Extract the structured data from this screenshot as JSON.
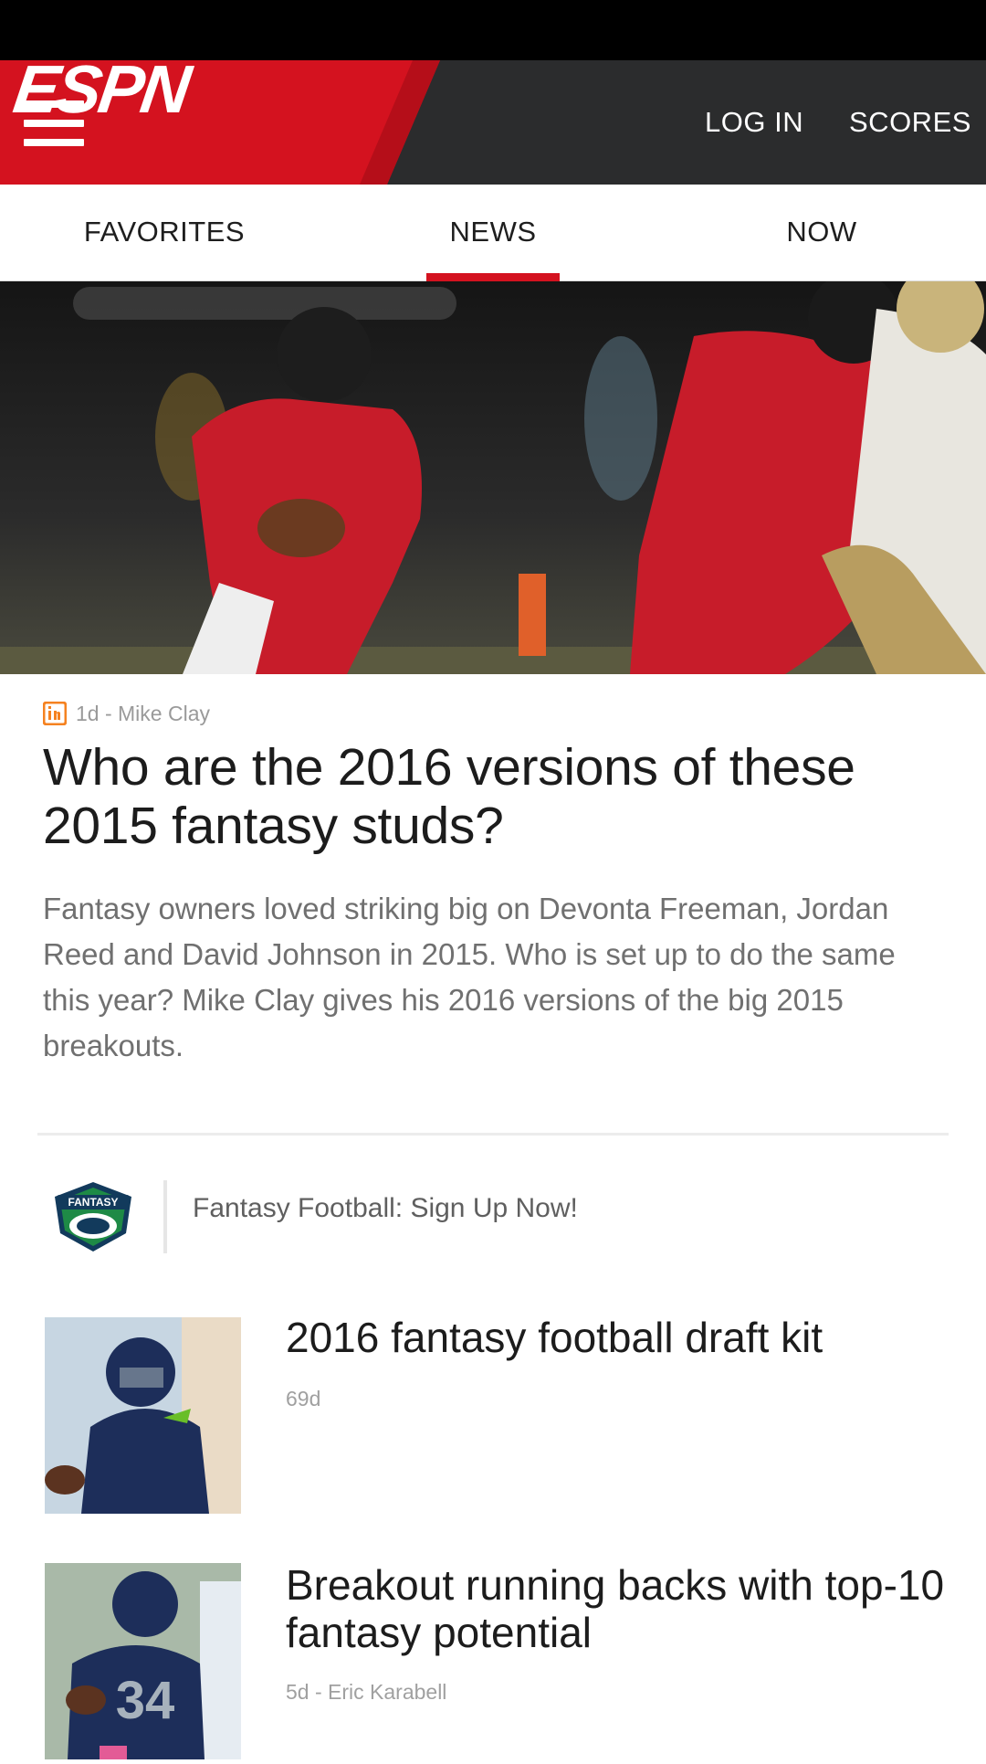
{
  "header": {
    "brand": "ESPN",
    "login_label": "LOG IN",
    "scores_label": "SCORES",
    "brand_color": "#d4121f"
  },
  "tabs": [
    {
      "label": "FAVORITES",
      "active": false
    },
    {
      "label": "NEWS",
      "active": true
    },
    {
      "label": "NOW",
      "active": false
    }
  ],
  "top_story": {
    "meta": "1d - Mike Clay",
    "badge_icon": "insider-icon",
    "headline": "Who are the 2016 versions of these 2015 fantasy studs?",
    "summary": "Fantasy owners loved striking big on Devonta Freeman, Jordan Reed and David Johnson in 2015. Who is set up to do the same this year? Mike Clay gives his 2016 versions of the big 2015 breakouts."
  },
  "promo": {
    "logo_text": "FANTASY",
    "label": "Fantasy Football: Sign Up Now!"
  },
  "items": [
    {
      "title": "2016 fantasy football draft kit",
      "meta": "69d"
    },
    {
      "title": "Breakout running backs with top-10 fantasy potential",
      "meta": "5d - Eric Karabell"
    }
  ]
}
